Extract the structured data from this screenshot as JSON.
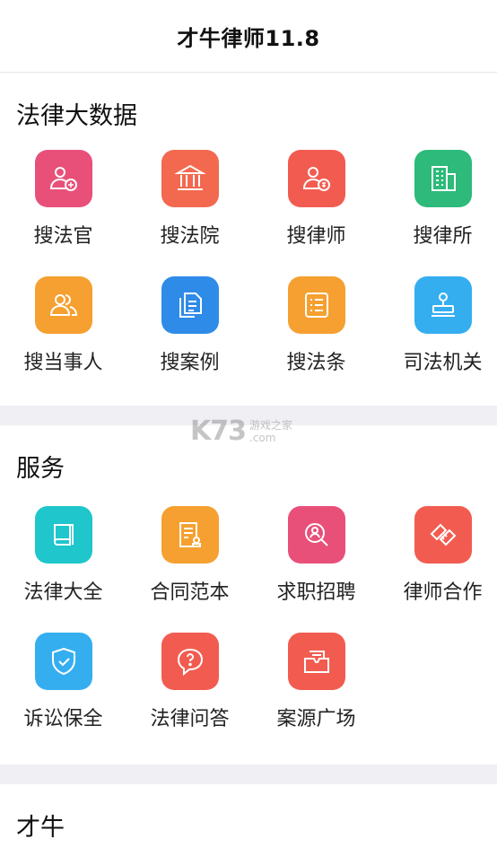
{
  "header": {
    "title": "才牛律师11.8"
  },
  "sections": [
    {
      "title": "法律大数据",
      "items": [
        {
          "label": "搜法官",
          "icon": "judge-icon",
          "color": "#e8507a"
        },
        {
          "label": "搜法院",
          "icon": "court-building-icon",
          "color": "#f2694f"
        },
        {
          "label": "搜律师",
          "icon": "lawyer-icon",
          "color": "#f25c50"
        },
        {
          "label": "搜律所",
          "icon": "office-building-icon",
          "color": "#2dba7a"
        },
        {
          "label": "搜当事人",
          "icon": "people-icon",
          "color": "#f5a030"
        },
        {
          "label": "搜案例",
          "icon": "documents-icon",
          "color": "#2f8be8"
        },
        {
          "label": "搜法条",
          "icon": "list-icon",
          "color": "#f5a030"
        },
        {
          "label": "司法机关",
          "icon": "stamp-icon",
          "color": "#35aef0"
        }
      ]
    },
    {
      "title": "服务",
      "items": [
        {
          "label": "法律大全",
          "icon": "book-icon",
          "color": "#1fc6cc"
        },
        {
          "label": "合同范本",
          "icon": "contract-icon",
          "color": "#f5a030"
        },
        {
          "label": "求职招聘",
          "icon": "job-search-icon",
          "color": "#e8507a"
        },
        {
          "label": "律师合作",
          "icon": "handshake-icon",
          "color": "#f25c50"
        },
        {
          "label": "诉讼保全",
          "icon": "shield-icon",
          "color": "#35aef0"
        },
        {
          "label": "法律问答",
          "icon": "question-bubble-icon",
          "color": "#f25c50"
        },
        {
          "label": "案源广场",
          "icon": "inbox-icon",
          "color": "#f25c50"
        }
      ]
    },
    {
      "title": "才牛"
    }
  ],
  "watermark": {
    "mark": "K73",
    "sub1": "游戏之家",
    "sub2": ".com"
  }
}
